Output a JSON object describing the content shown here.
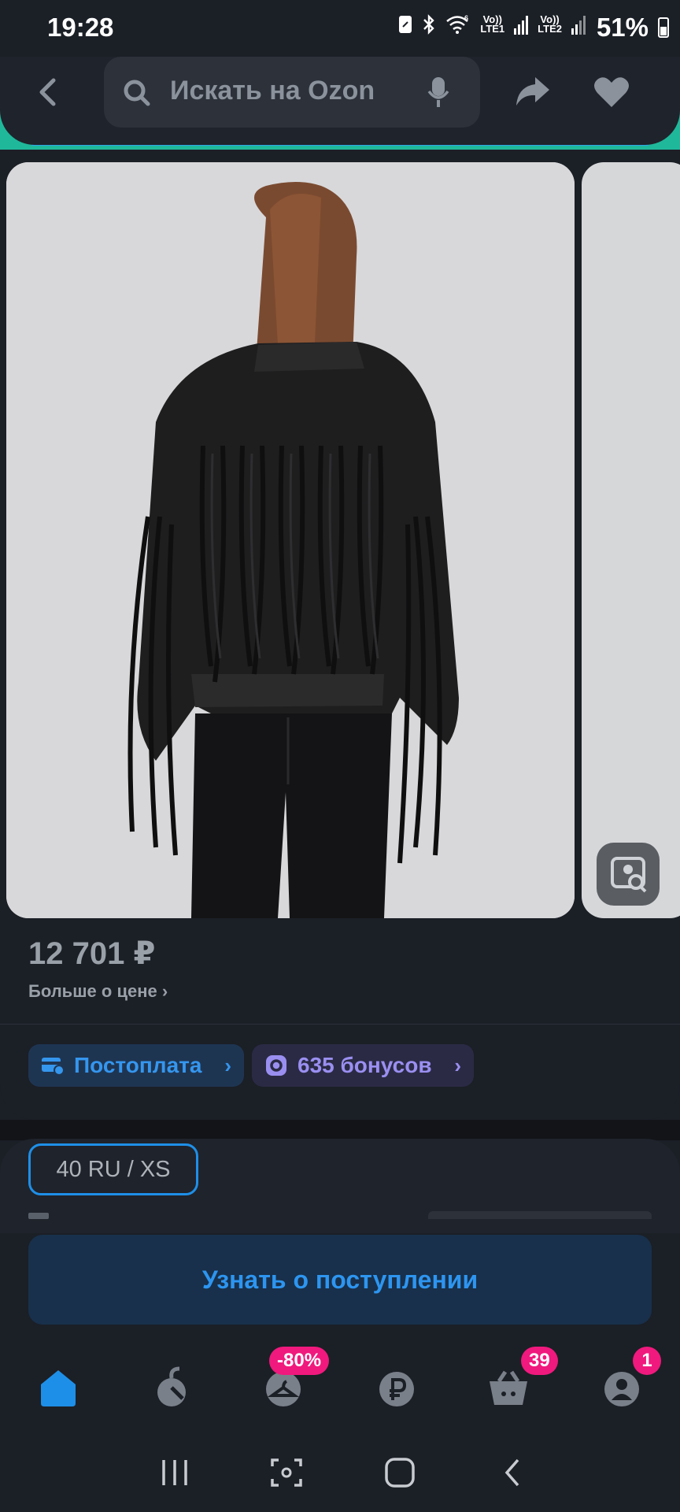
{
  "status_bar": {
    "time": "19:28",
    "net1_top": "Vo))",
    "net1_bottom": "LTE1",
    "net2_top": "Vo))",
    "net2_bottom": "LTE2",
    "wifi_label": "6",
    "battery": "51%"
  },
  "header": {
    "search_placeholder": "Искать на Ozon",
    "icons": [
      "back-arrow-icon",
      "search-icon",
      "microphone-icon",
      "share-icon",
      "heart-icon"
    ]
  },
  "product": {
    "price": "12 701 ₽",
    "price_more": "Больше о цене",
    "price_more_chevron": "›",
    "postpay": "Постоплата",
    "bonus": "635 бонусов",
    "size": "40 RU / XS",
    "cta": "Узнать о поступлении"
  },
  "tabbar": {
    "discount_badge": "-80%",
    "cart_badge": "39",
    "profile_badge": "1",
    "items": [
      "home-icon",
      "fresh-icon",
      "hanger-icon",
      "ruble-icon",
      "cart-icon",
      "profile-icon"
    ]
  },
  "colors": {
    "background": "#1b1f26",
    "accent_blue": "#2d95f0",
    "badge_pink": "#f0197d",
    "bonus_purple": "#9a8ff0"
  }
}
